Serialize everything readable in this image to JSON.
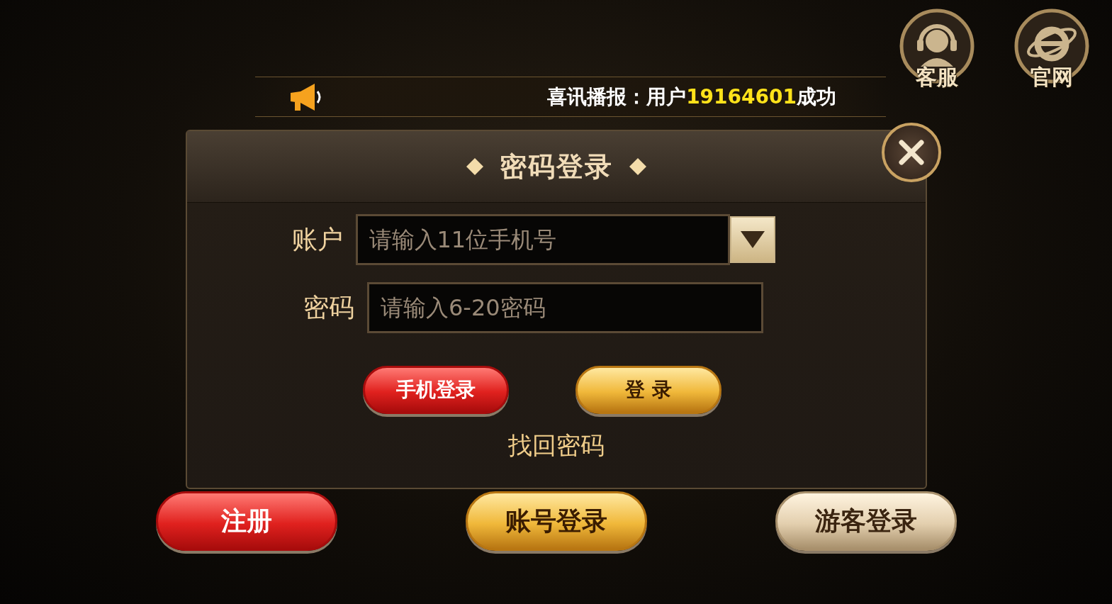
{
  "top_buttons": [
    {
      "kind": "headset",
      "label": "客服"
    },
    {
      "kind": "browser",
      "label": "官网"
    }
  ],
  "announcement": {
    "text": "喜讯播报：用户**19164601**成功"
  },
  "dialog": {
    "title": "密码登录",
    "fields": [
      {
        "kind": "dropdown",
        "label": "账户",
        "placeholder": "请输入11位手机号"
      },
      {
        "kind": "text",
        "label": "密码",
        "placeholder": "请输入6-20密码"
      }
    ],
    "buttons": [
      {
        "kind": "red",
        "label": "手机登录"
      },
      {
        "kind": "gold",
        "label": "登 录"
      }
    ],
    "link": "找回密码"
  },
  "bottom_buttons": [
    {
      "kind": "red",
      "label": "注册"
    },
    {
      "kind": "gold",
      "label": "账号登录"
    },
    {
      "kind": "beige",
      "label": "游客登录"
    }
  ]
}
